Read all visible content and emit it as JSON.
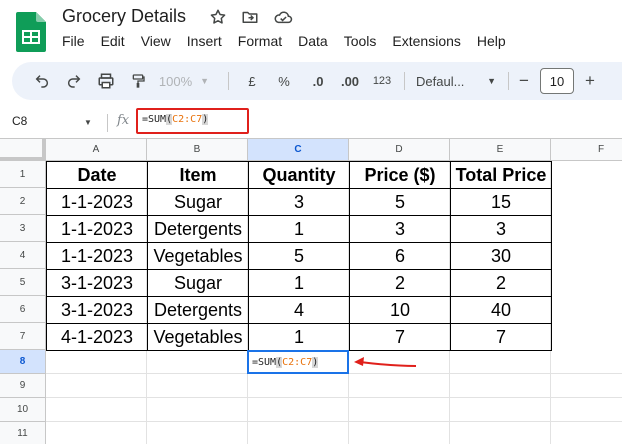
{
  "app": {
    "title": "Grocery Details",
    "menu": [
      "File",
      "Edit",
      "View",
      "Insert",
      "Format",
      "Data",
      "Tools",
      "Extensions",
      "Help"
    ]
  },
  "toolbar": {
    "zoom": "100%",
    "currency": "£",
    "percent": "%",
    "decrease_decimal": ".0",
    "increase_decimal": ".00",
    "more_formats": "123",
    "font": "Defaul...",
    "font_size": "10",
    "minus": "−",
    "plus": "+"
  },
  "formula_bar": {
    "cell_ref": "C8",
    "fx": "fx",
    "formula_fn": "=SUM",
    "formula_open": "(",
    "formula_range": "C2:C7",
    "formula_close": ")"
  },
  "grid": {
    "columns": [
      "A",
      "B",
      "C",
      "D",
      "E",
      "F"
    ],
    "rows": [
      "1",
      "2",
      "3",
      "4",
      "5",
      "6",
      "7",
      "8",
      "9",
      "10",
      "11"
    ],
    "active_column": "C",
    "active_row": "8",
    "headers": [
      "Date",
      "Item",
      "Quantity",
      "Price ($)",
      "Total Price"
    ],
    "data": [
      [
        "1-1-2023",
        "Sugar",
        "3",
        "5",
        "15"
      ],
      [
        "1-1-2023",
        "Detergents",
        "1",
        "3",
        "3"
      ],
      [
        "1-1-2023",
        "Vegetables",
        "5",
        "6",
        "30"
      ],
      [
        "3-1-2023",
        "Sugar",
        "1",
        "2",
        "2"
      ],
      [
        "3-1-2023",
        "Detergents",
        "4",
        "10",
        "40"
      ],
      [
        "4-1-2023",
        "Vegetables",
        "1",
        "7",
        "7"
      ]
    ],
    "active_cell": {
      "fn": "=SUM",
      "open": "(",
      "range": "C2:C7",
      "close": ")"
    }
  },
  "colors": {
    "highlight_box": "#e0201b",
    "selection": "#1a73e8",
    "toolbar_bg": "#edf2fa",
    "range_text": "#e8710a"
  }
}
